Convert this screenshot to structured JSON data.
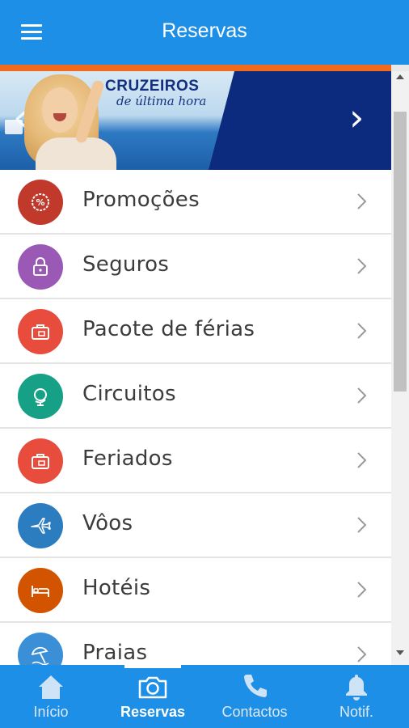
{
  "header": {
    "title": "Reservas",
    "menu_icon": "hamburger-menu-icon"
  },
  "banner": {
    "headline": "CRUZEIROS",
    "subline": "de última hora",
    "prev_icon": "chevron-left-icon",
    "next_icon": "chevron-right-icon",
    "prev_glyph": "‹",
    "next_glyph": "›"
  },
  "menu_items": [
    {
      "label": "Promoções",
      "icon": "percent-badge-icon",
      "color": "#c0392b"
    },
    {
      "label": "Seguros",
      "icon": "padlock-icon",
      "color": "#9b59b6"
    },
    {
      "label": "Pacote de férias",
      "icon": "suitcase-icon",
      "color": "#e74c3c"
    },
    {
      "label": "Circuitos",
      "icon": "globe-icon",
      "color": "#16a085"
    },
    {
      "label": "Feriados",
      "icon": "suitcase-icon",
      "color": "#e74c3c"
    },
    {
      "label": "Vôos",
      "icon": "airplane-icon",
      "color": "#2c7cc0"
    },
    {
      "label": "Hotéis",
      "icon": "bed-icon",
      "color": "#d35400"
    },
    {
      "label": "Praias",
      "icon": "beach-umbrella-icon",
      "color": "#3b8fd6"
    }
  ],
  "tabs": [
    {
      "label": "Início",
      "icon": "home-icon",
      "active": false
    },
    {
      "label": "Reservas",
      "icon": "camera-icon",
      "active": true
    },
    {
      "label": "Contactos",
      "icon": "phone-icon",
      "active": false
    },
    {
      "label": "Notif.",
      "icon": "bell-icon",
      "active": false
    }
  ],
  "colors": {
    "primary": "#1e8fe6",
    "accent": "#f26b1d",
    "banner_navy": "#0c2b7e"
  }
}
